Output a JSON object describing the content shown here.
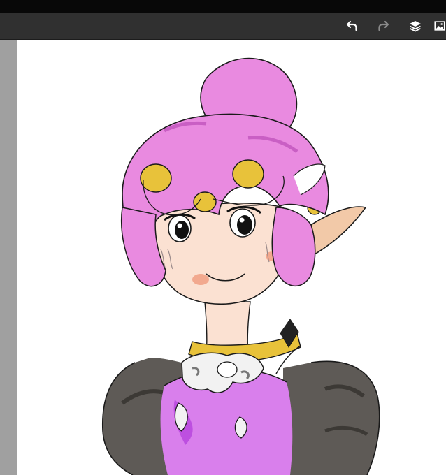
{
  "toolbar": {
    "items": [
      {
        "icon": "undo-icon",
        "enabled": true
      },
      {
        "icon": "redo-icon",
        "enabled": false
      },
      {
        "icon": "layers-icon",
        "enabled": true
      },
      {
        "icon": "image-icon",
        "enabled": true
      }
    ]
  },
  "colors": {
    "toolbar_bg": "#303030",
    "left_panel": "#a0a0a0",
    "canvas_bg": "#ffffff",
    "hair": "#e98ae0",
    "skin": "#fbe1d2",
    "gold": "#e8c23a",
    "dress": "#d97fec",
    "jacket": "#5e5a56"
  }
}
